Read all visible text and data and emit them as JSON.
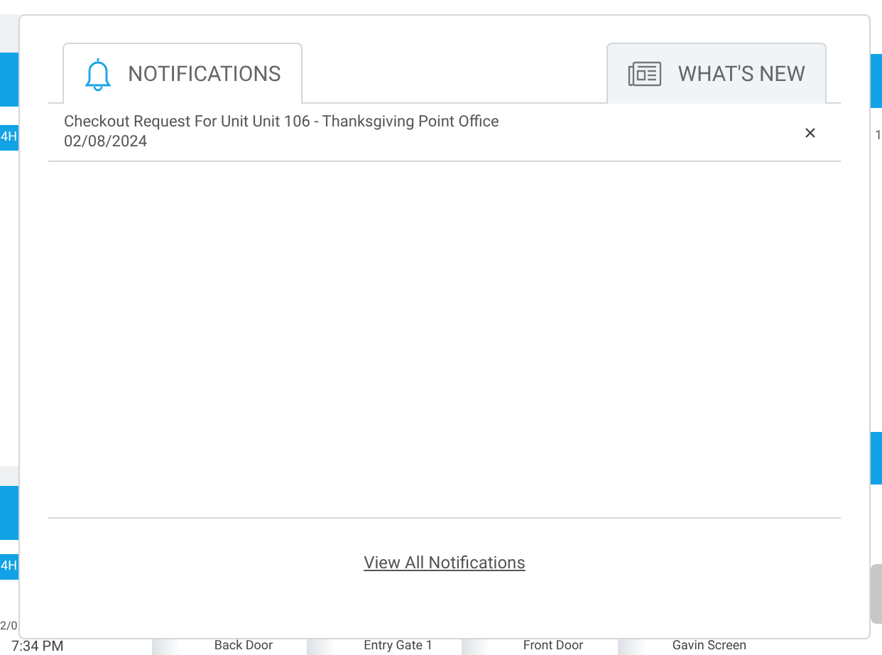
{
  "background": {
    "left_labels": [
      "4H",
      "4H"
    ],
    "date": "2/0",
    "time": "7:34 PM",
    "right_label": "1",
    "door_buttons": [
      "Back Door",
      "Entry Gate 1",
      "Front Door",
      "Gavin Screen"
    ]
  },
  "tabs": [
    {
      "label": "NOTIFICATIONS",
      "kind": "notifications",
      "selected": true
    },
    {
      "label": "WHAT'S NEW",
      "kind": "news",
      "selected": false
    }
  ],
  "notifications": [
    {
      "title": "Checkout Request For Unit Unit 106 - Thanksgiving Point Office",
      "date": "02/08/2024"
    }
  ],
  "footer_link": "View All Notifications"
}
